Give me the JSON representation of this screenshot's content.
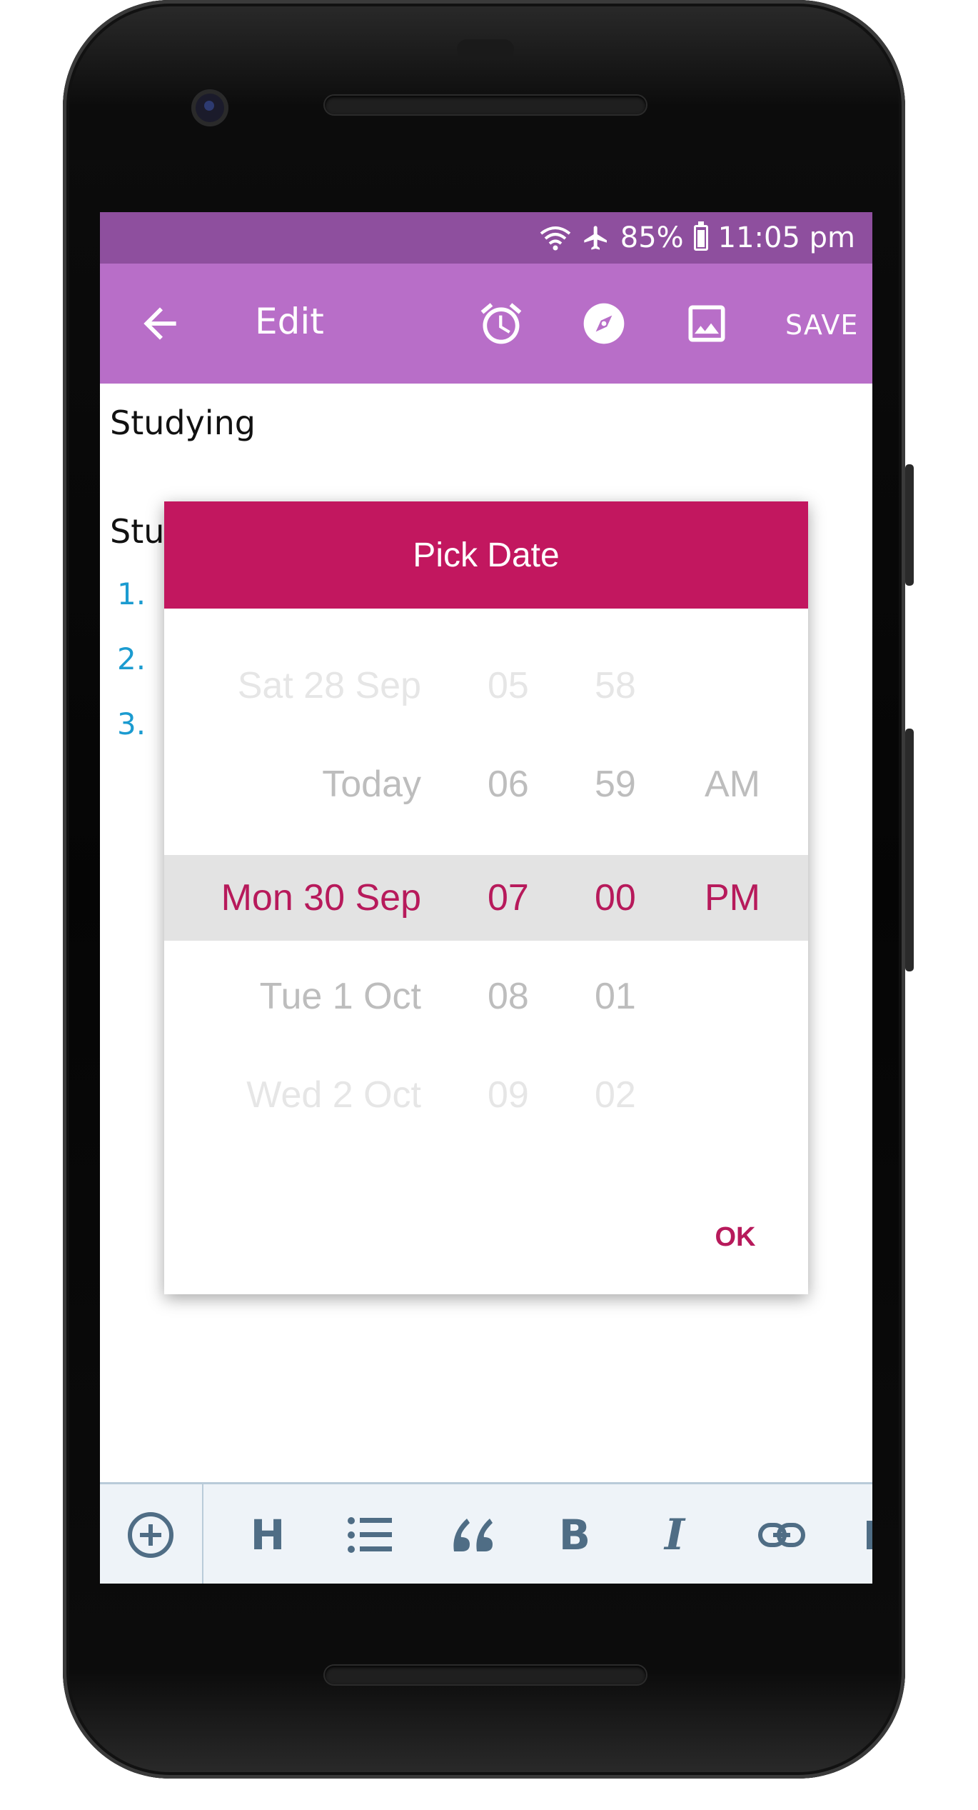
{
  "status_bar": {
    "battery": "85%",
    "time": "11:05 pm",
    "icons": [
      "wifi-icon",
      "airplane-icon",
      "battery-icon"
    ]
  },
  "app_bar": {
    "title": "Edit",
    "save_label": "SAVE",
    "icons": [
      "back-arrow-icon",
      "alarm-icon",
      "compass-icon",
      "image-icon"
    ],
    "color": "#b86ec8"
  },
  "note": {
    "title": "Studying",
    "body_prefix": "Stud",
    "numbers": [
      "1.",
      "2.",
      "3."
    ]
  },
  "dialog": {
    "title": "Pick Date",
    "ok_label": "OK",
    "accent": "#c2175f",
    "rows": [
      {
        "date": "Sat 28 Sep",
        "hour": "05",
        "minute": "58",
        "ampm": ""
      },
      {
        "date": "Today",
        "hour": "06",
        "minute": "59",
        "ampm": "AM"
      },
      {
        "date": "Mon 30 Sep",
        "hour": "07",
        "minute": "00",
        "ampm": "PM"
      },
      {
        "date": "Tue 1 Oct",
        "hour": "08",
        "minute": "01",
        "ampm": ""
      },
      {
        "date": "Wed 2 Oct",
        "hour": "09",
        "minute": "02",
        "ampm": ""
      }
    ]
  },
  "toolbar": {
    "heading_label": "H",
    "bold_label": "B",
    "italic_label": "I",
    "icons": [
      "add-circle-icon",
      "heading-icon",
      "bullet-list-icon",
      "quote-icon",
      "bold-icon",
      "italic-icon",
      "link-icon"
    ]
  }
}
